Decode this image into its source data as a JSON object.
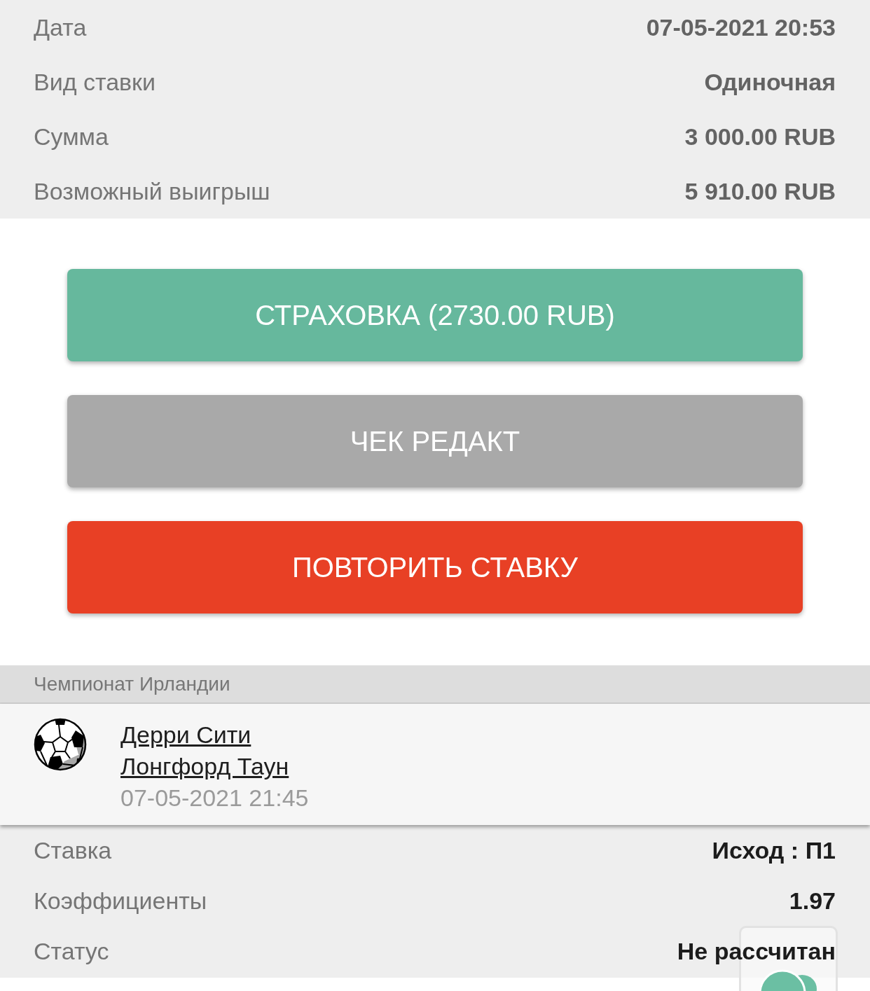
{
  "summary": [
    {
      "label": "Дата",
      "value": "07-05-2021 20:53"
    },
    {
      "label": "Вид ставки",
      "value": "Одиночная"
    },
    {
      "label": "Сумма",
      "value": "3 000.00 RUB"
    },
    {
      "label": "Возможный выигрыш",
      "value": "5 910.00 RUB"
    }
  ],
  "actions": [
    {
      "label": "СТРАХОВКА (2730.00 RUB)",
      "kind": "insurance"
    },
    {
      "label": "ЧЕК РЕДАКТ",
      "kind": "receipt"
    },
    {
      "label": "ПОВТОРИТЬ СТАВКУ",
      "kind": "repeat"
    }
  ],
  "event": {
    "league": "Чемпионат Ирландии",
    "teams": [
      "Дерри Сити",
      "Лонгфорд Таун"
    ],
    "start": "07-05-2021 21:45"
  },
  "bet_details": [
    {
      "label": "Ставка",
      "value": "Исход : П1"
    },
    {
      "label": "Коэффициенты",
      "value": "1.97"
    },
    {
      "label": "Статус",
      "value": "Не рассчитан"
    }
  ]
}
